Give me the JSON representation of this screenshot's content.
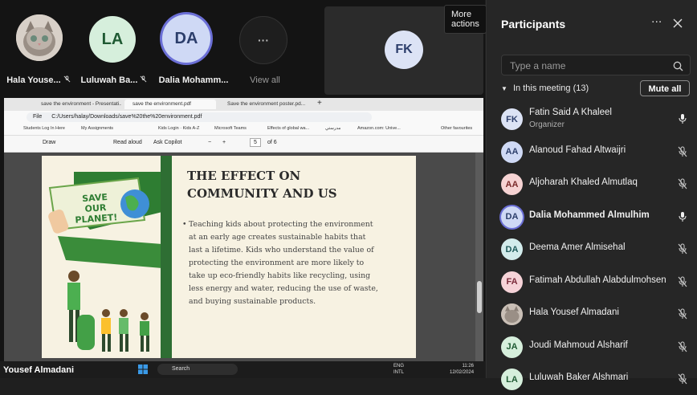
{
  "video_strip": {
    "tiles": [
      {
        "initials": "",
        "name": "Hala Youse...",
        "muted": true
      },
      {
        "initials": "LA",
        "name": "Luluwah Ba...",
        "muted": true
      },
      {
        "initials": "DA",
        "name": "Dalia Mohamm...",
        "muted": true
      },
      {
        "initials": "",
        "name": "View all",
        "muted": false
      }
    ],
    "fk_initials": "FK",
    "tooltip": "More actions",
    "overflow": "···"
  },
  "browser": {
    "tabs": [
      "save the environment - Presentati...",
      "save the environment.pdf",
      "Save the environment poster.pd..."
    ],
    "new_tab": "+",
    "file_label": "File",
    "address": "C:/Users/halay/Downloads/save%20the%20environment.pdf",
    "bookmarks": [
      "Students Log In Here",
      "My Assignments",
      "Kids Login · Kids A-Z",
      "Microsoft Teams",
      "Effects of global wa...",
      "مدرستي",
      "Amazon.com: Unive...",
      "Other favourites"
    ],
    "pdf_toolbar": {
      "draw": "Draw",
      "read_aloud": "Read aloud",
      "ask_copilot": "Ask Copilot",
      "minus": "−",
      "plus": "+",
      "page_current": "5",
      "page_total": "of 6"
    }
  },
  "slide": {
    "title_line1": "THE EFFECT ON",
    "title_line2": "COMMUNITY AND US",
    "bullet": "Teaching kids about protecting the environment at an early age creates sustainable habits that last a lifetime. Kids who understand the value of protecting the environment are more likely to take up eco-friendly habits like recycling, using less energy and water, reducing the use of waste, and buying sustainable products.",
    "banner_line1": "SAVE",
    "banner_line2": "OUR",
    "banner_line3": "PLANET!"
  },
  "presenter": {
    "name": "Yousef Almadani"
  },
  "taskbar": {
    "search": "Search",
    "lang1": "ENG",
    "lang2": "INTL",
    "time": "11:26",
    "date": "12/02/2024"
  },
  "participants": {
    "title": "Participants",
    "search_placeholder": "Type a name",
    "section": "In this meeting (13)",
    "mute_all": "Mute all",
    "people": [
      {
        "initials": "FK",
        "name": "Fatin Said A Khaleel",
        "role": "Organizer",
        "muted": false,
        "bg": "#dce3f5",
        "fg": "#2c3e6b"
      },
      {
        "initials": "AA",
        "name": "Alanoud Fahad Altwaijri",
        "role": "",
        "muted": true,
        "bg": "#cfd9f5",
        "fg": "#2c3e6b"
      },
      {
        "initials": "AA",
        "name": "Aljoharah Khaled Almutlaq",
        "role": "",
        "muted": true,
        "bg": "#f6d3d3",
        "fg": "#7a2a2a"
      },
      {
        "initials": "DA",
        "name": "Dalia Mohammed Almulhim",
        "role": "",
        "muted": false,
        "bg": "#cfd9f5",
        "fg": "#2c3e6b"
      },
      {
        "initials": "DA",
        "name": "Deema Amer Almisehal",
        "role": "",
        "muted": true,
        "bg": "#d3ecec",
        "fg": "#1f5a5a"
      },
      {
        "initials": "FA",
        "name": "Fatimah Abdullah Alabdulmohsen",
        "role": "",
        "muted": true,
        "bg": "#f6d3d8",
        "fg": "#7a2a3a"
      },
      {
        "initials": "",
        "name": "Hala Yousef Almadani",
        "role": "",
        "muted": true,
        "bg": "#b8a89a",
        "fg": "#333"
      },
      {
        "initials": "JA",
        "name": "Joudi Mahmoud Alsharif",
        "role": "",
        "muted": true,
        "bg": "#d6efdc",
        "fg": "#1f5a33"
      },
      {
        "initials": "LA",
        "name": "Luluwah Baker Alshmari",
        "role": "",
        "muted": true,
        "bg": "#d6efdc",
        "fg": "#1f5a33"
      }
    ]
  }
}
